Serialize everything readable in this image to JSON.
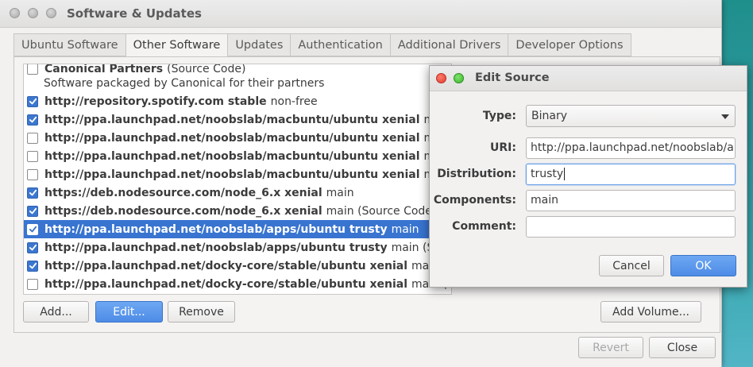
{
  "window": {
    "title": "Software & Updates",
    "tabs": [
      {
        "label": "Ubuntu Software",
        "active": false
      },
      {
        "label": "Other Software",
        "active": true
      },
      {
        "label": "Updates",
        "active": false
      },
      {
        "label": "Authentication",
        "active": false
      },
      {
        "label": "Additional Drivers",
        "active": false
      },
      {
        "label": "Developer Options",
        "active": false
      }
    ]
  },
  "sources": [
    {
      "url": "Canonical Partners",
      "suffix": "(Source Code)",
      "checked": false,
      "partial": true
    },
    {
      "url": "",
      "suffix": "Software packaged by Canonical for their partners",
      "checked": false,
      "description_line": true
    },
    {
      "url": "http://repository.spotify.com stable",
      "suffix": "non-free",
      "checked": true
    },
    {
      "url": "http://ppa.launchpad.net/noobslab/macbuntu/ubuntu xenial",
      "suffix": "main",
      "checked": true
    },
    {
      "url": "http://ppa.launchpad.net/noobslab/macbuntu/ubuntu xenial",
      "suffix": "main (",
      "checked": false
    },
    {
      "url": "http://ppa.launchpad.net/noobslab/macbuntu/ubuntu xenial",
      "suffix": "main (",
      "checked": false
    },
    {
      "url": "http://ppa.launchpad.net/noobslab/macbuntu/ubuntu xenial",
      "suffix": "main (",
      "checked": false
    },
    {
      "url": "https://deb.nodesource.com/node_6.x xenial",
      "suffix": "main",
      "checked": true
    },
    {
      "url": "https://deb.nodesource.com/node_6.x xenial",
      "suffix": "main (Source Code)",
      "checked": true
    },
    {
      "url": "http://ppa.launchpad.net/noobslab/apps/ubuntu trusty",
      "suffix": "main",
      "checked": true,
      "selected": true
    },
    {
      "url": "http://ppa.launchpad.net/noobslab/apps/ubuntu trusty",
      "suffix": "main (Source",
      "checked": true
    },
    {
      "url": "http://ppa.launchpad.net/docky-core/stable/ubuntu xenial",
      "suffix": "main",
      "checked": true
    },
    {
      "url": "http://ppa.launchpad.net/docky-core/stable/ubuntu xenial",
      "suffix": "main (So",
      "checked": false
    }
  ],
  "buttons": {
    "add": "Add...",
    "edit": "Edit...",
    "remove": "Remove",
    "add_volume": "Add Volume...",
    "revert": "Revert",
    "close": "Close"
  },
  "dialog": {
    "title": "Edit Source",
    "type_label": "Type:",
    "type_value": "Binary",
    "uri_label": "URI:",
    "uri_value": "http://ppa.launchpad.net/noobslab/a",
    "distribution_label": "Distribution:",
    "distribution_value": "trusty",
    "components_label": "Components:",
    "components_value": "main",
    "comment_label": "Comment:",
    "comment_value": "",
    "cancel": "Cancel",
    "ok": "OK"
  },
  "colors": {
    "selection": "#3874d0",
    "checkbox_checked": "#3c77cf",
    "ok_button": "#4d8be6",
    "desktop": "#2f9aa0"
  }
}
